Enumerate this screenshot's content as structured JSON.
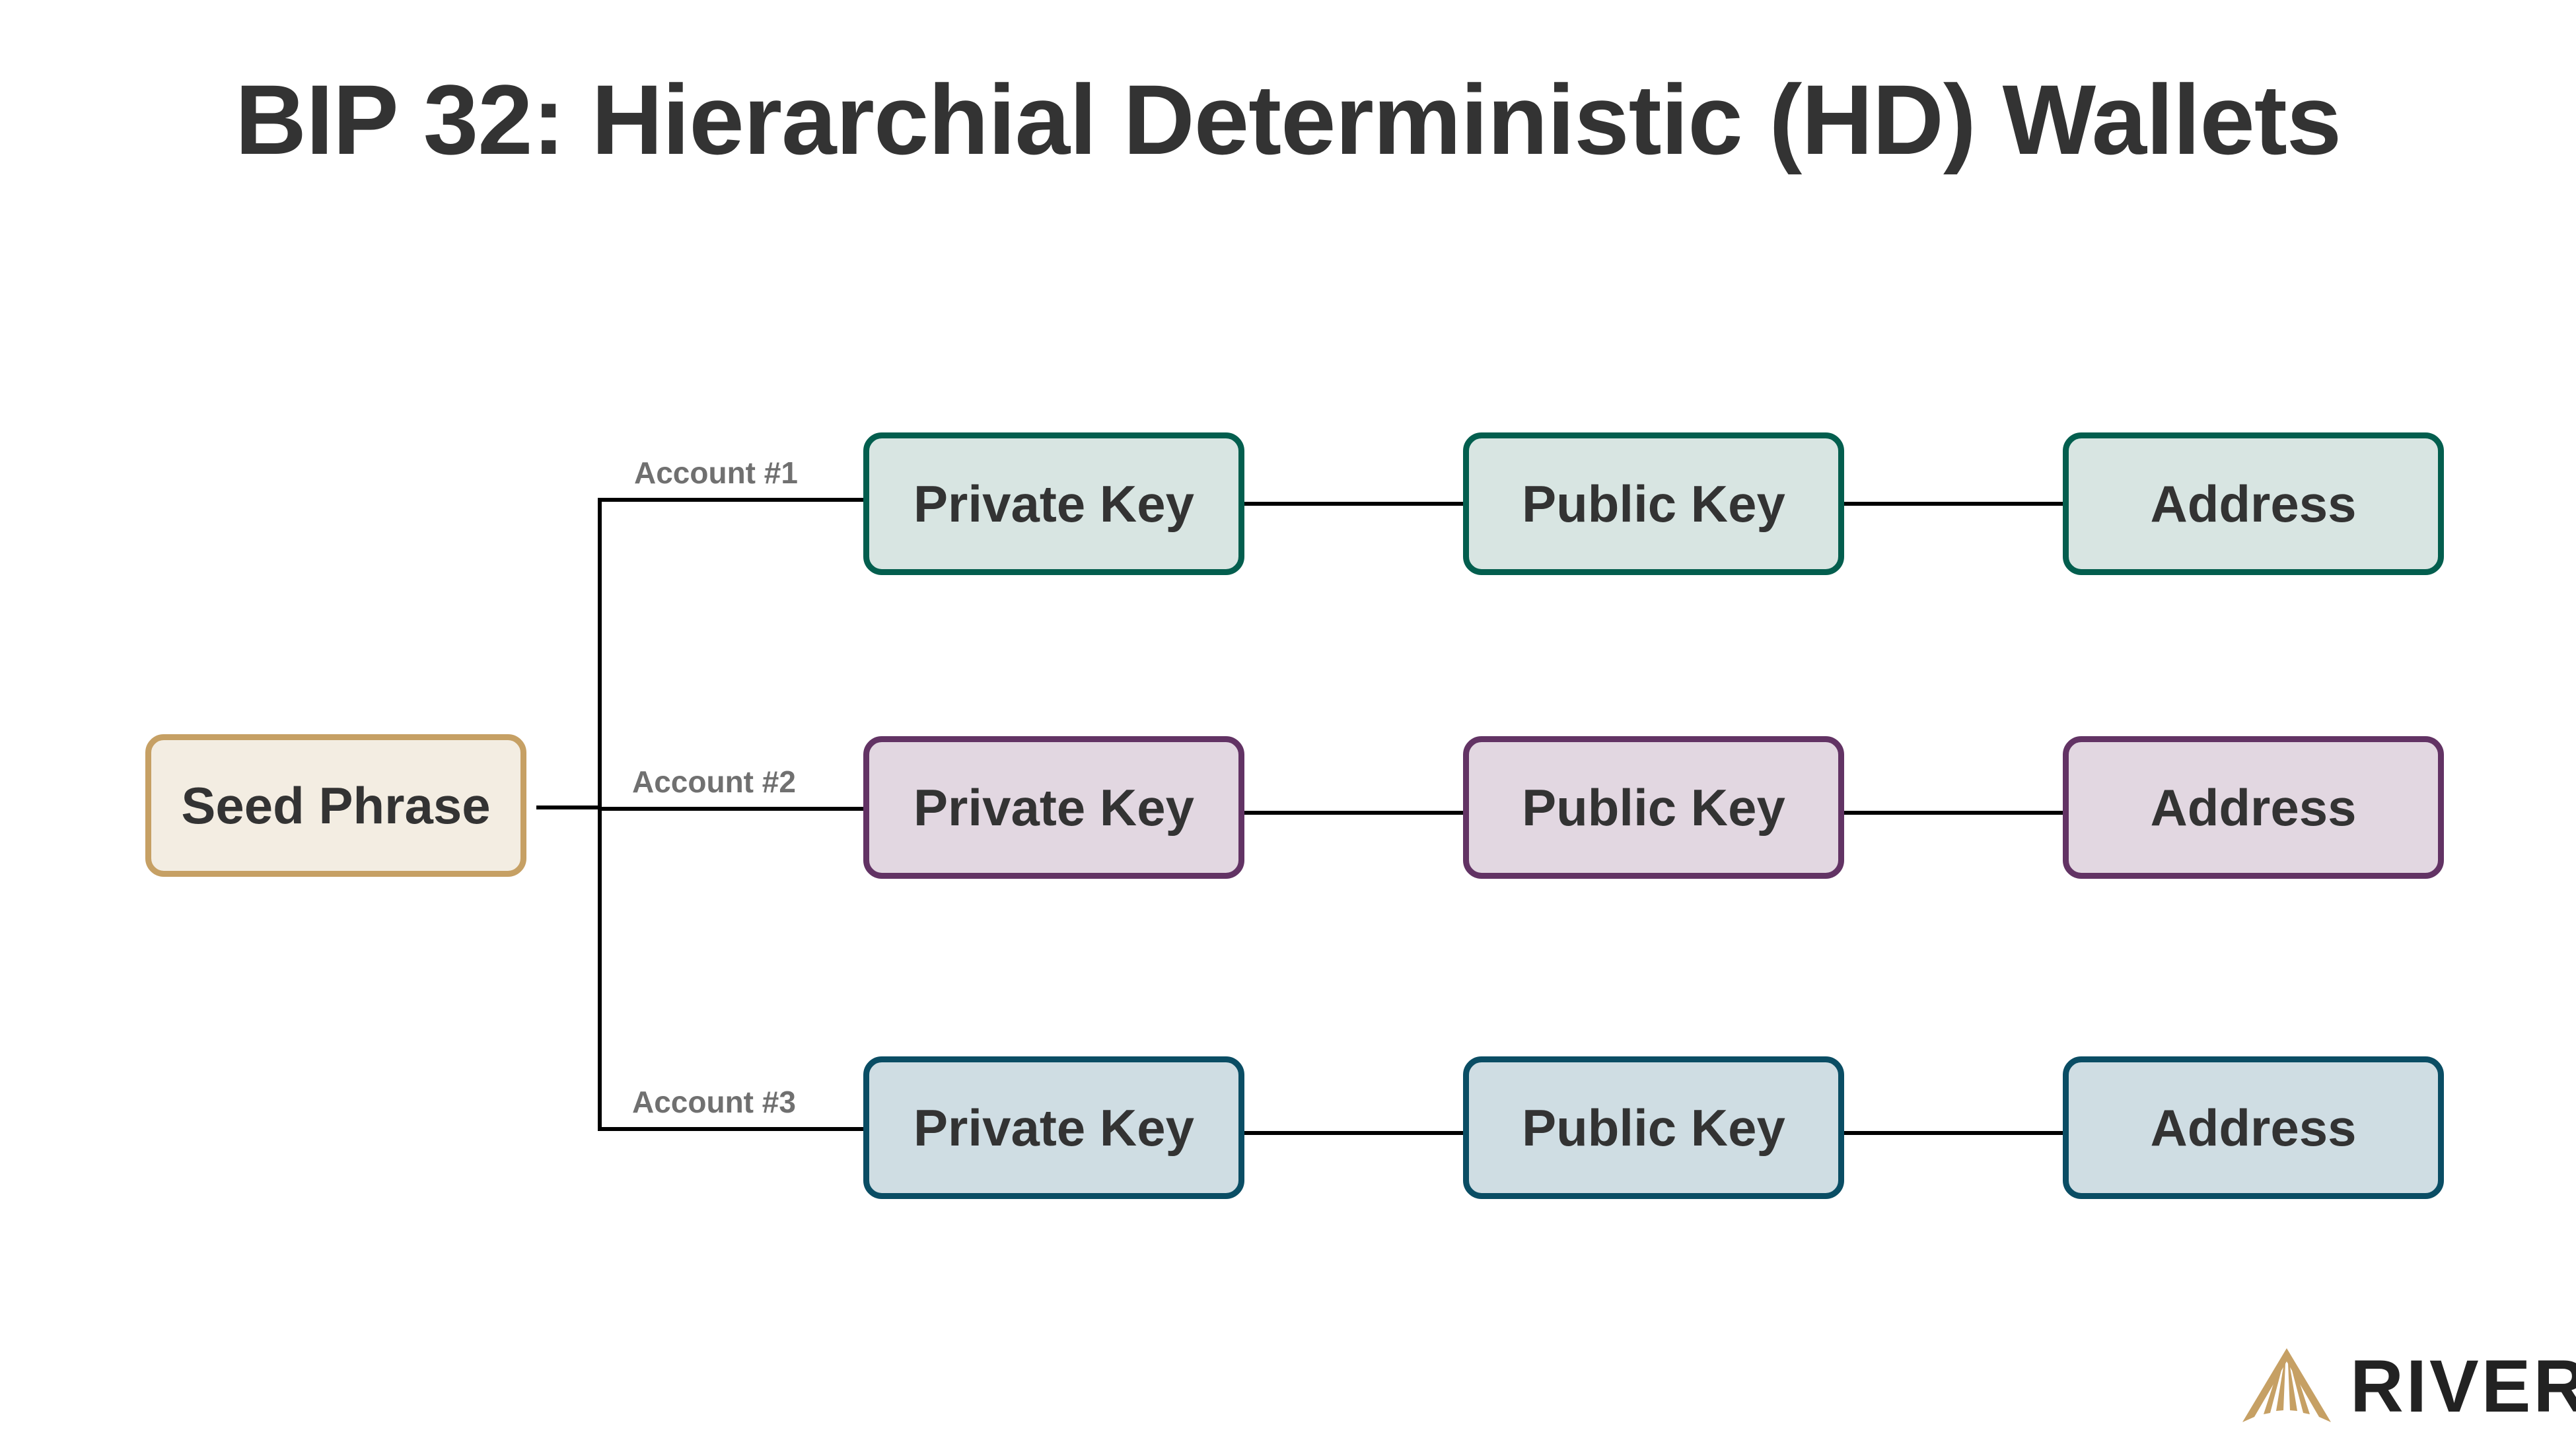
{
  "title": "BIP 32: Hierarchial Deterministic (HD) Wallets",
  "seed": {
    "label": "Seed Phrase",
    "fill": "#f3ede2",
    "stroke": "#c6a064"
  },
  "accounts": [
    {
      "label": "Account #1",
      "fill": "#d8e5e2",
      "stroke": "#035e4e",
      "nodes": [
        "Private Key",
        "Public Key",
        "Address"
      ]
    },
    {
      "label": "Account #2",
      "fill": "#e2d7e1",
      "stroke": "#623364",
      "nodes": [
        "Private Key",
        "Public Key",
        "Address"
      ]
    },
    {
      "label": "Account #3",
      "fill": "#cfdde3",
      "stroke": "#0a4d64",
      "nodes": [
        "Private Key",
        "Public Key",
        "Address"
      ]
    }
  ],
  "logo": {
    "icon": "river-logo-icon",
    "text": "RIVER",
    "color": "#c6a064"
  },
  "line_color": "#000000"
}
